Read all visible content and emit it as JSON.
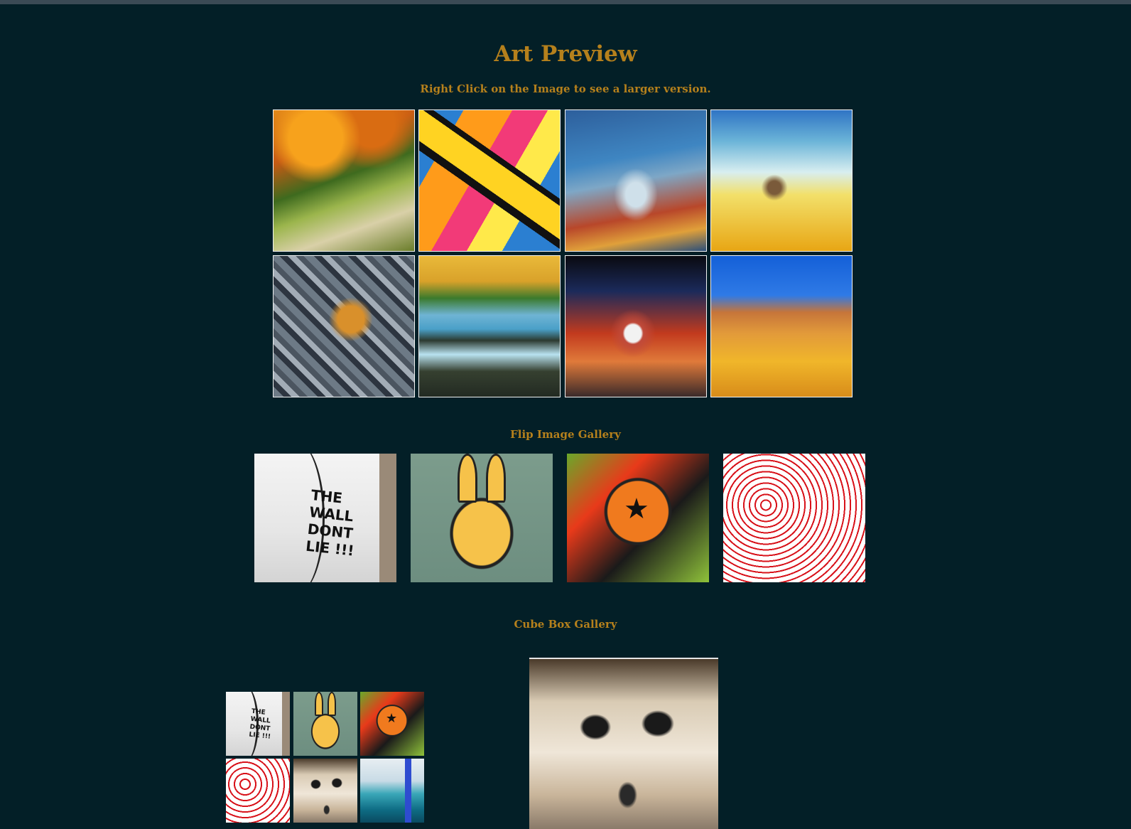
{
  "page": {
    "title": "Art Preview",
    "subtitle": "Right Click on the Image to see a larger version."
  },
  "preview_gallery": {
    "images": [
      {
        "name": "autumn-path-painting"
      },
      {
        "name": "graffiti-letters"
      },
      {
        "name": "water-splash"
      },
      {
        "name": "beach-painting"
      },
      {
        "name": "metal-number-one"
      },
      {
        "name": "waterfall-painting"
      },
      {
        "name": "glass-droplet"
      },
      {
        "name": "house-painting"
      }
    ]
  },
  "flip_gallery": {
    "title": "Flip Image Gallery",
    "wall_text": "THE WALL DONT LIE !!!"
  },
  "cube_gallery": {
    "title": "Cube Box Gallery",
    "wall_text": "THE WALL DONT LIE !!!"
  },
  "colors": {
    "background": "#031f27",
    "accent": "#b5801c",
    "tile_border": "#f3f3f3"
  }
}
